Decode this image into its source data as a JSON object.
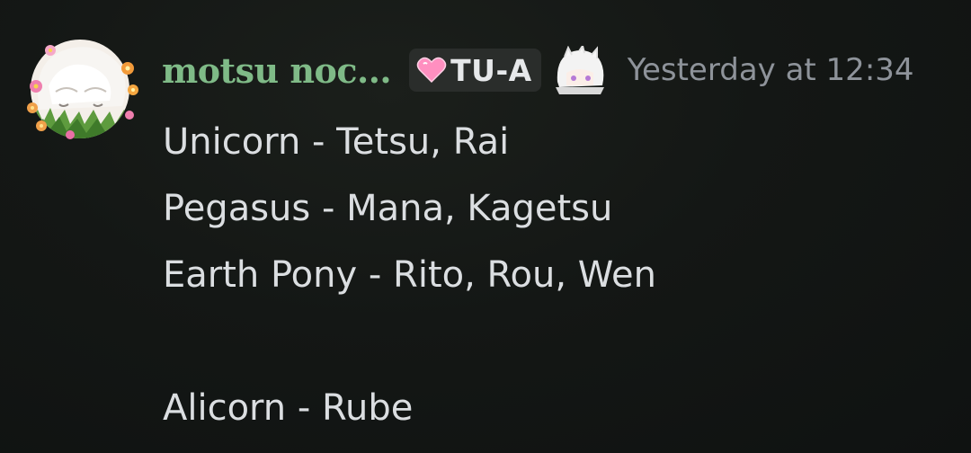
{
  "message": {
    "author": {
      "display_name": "motsu noc...",
      "name_color": "#7fba87",
      "avatar_icon": "white-haired-character-flower-wreath-avatar"
    },
    "role_tag": {
      "icon": "pink-heart-icon",
      "label": "TU-A"
    },
    "emoji_icon": "white-haired-chibi-emoji",
    "timestamp": "Yesterday at 12:34",
    "lines": [
      "Unicorn - Tetsu, Rai",
      "Pegasus - Mana, Kagetsu",
      "Earth Pony - Rito, Rou, Wen",
      "",
      "Alicorn - Rube"
    ]
  }
}
